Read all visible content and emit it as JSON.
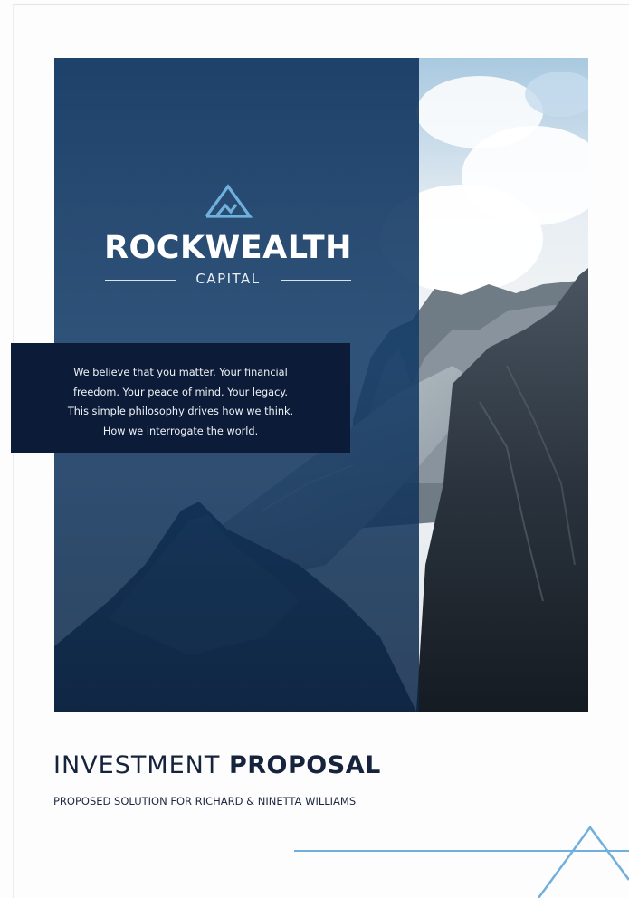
{
  "brand": {
    "name": "ROCKWEALTH",
    "sub": "CAPITAL",
    "logo_icon": "mountain-icon",
    "accent_color": "#6fb0dc"
  },
  "philosophy": {
    "lines": [
      "We believe that you matter. Your financial",
      "freedom. Your peace of mind. Your legacy.",
      "This simple philosophy drives how we think.",
      "How we interrogate the world."
    ]
  },
  "proposal": {
    "title_light": "INVESTMENT",
    "title_bold": "PROPOSAL",
    "subtitle": "PROPOSED SOLUTION FOR RICHARD & NINETTA WILLIAMS"
  },
  "colors": {
    "panel_blue": "#123660",
    "box_navy": "#0c1c38",
    "text_dark": "#16233c"
  }
}
